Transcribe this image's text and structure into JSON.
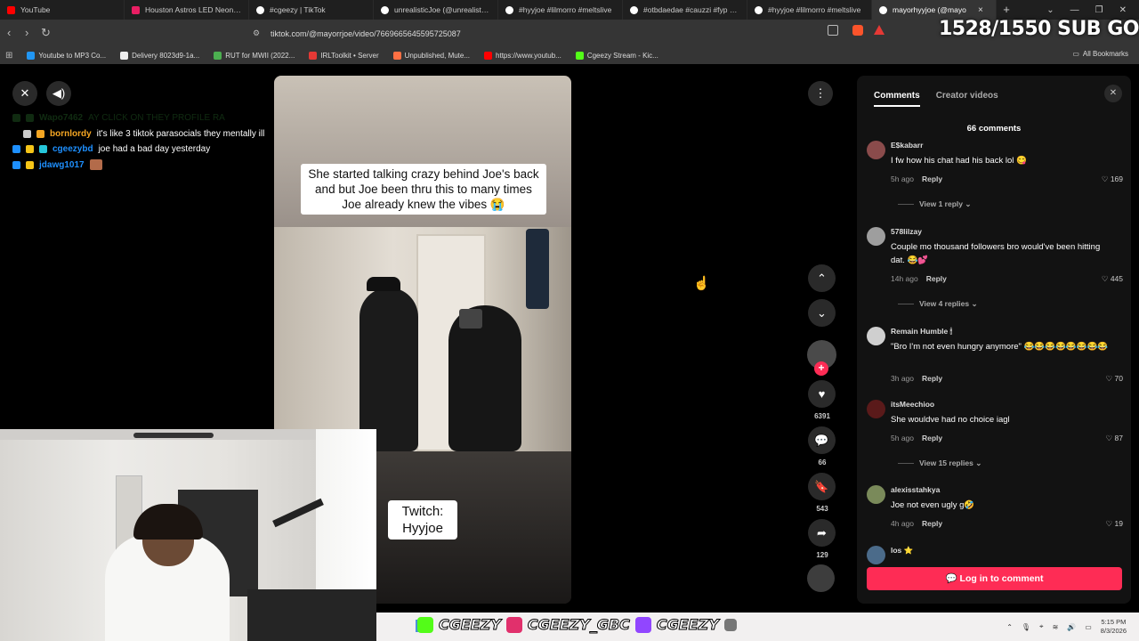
{
  "browser": {
    "tabs": [
      {
        "title": "YouTube",
        "color": "#ff0000"
      },
      {
        "title": "Houston Astros LED Neon Lig",
        "color": "#e91e63"
      },
      {
        "title": "#cgeezy | TikTok",
        "color": "#ffffff"
      },
      {
        "title": "unrealisticJoe (@unrealisticjoe",
        "color": "#ffffff"
      },
      {
        "title": "#hyyjoe #lilmorro #meltslive",
        "color": "#ffffff"
      },
      {
        "title": "#otbdaedae #cauzzi #fyp @C",
        "color": "#ffffff"
      },
      {
        "title": "#hyyjoe #lilmorro #meltslive",
        "color": "#ffffff"
      },
      {
        "title": "mayorhyyjoe (@mayo",
        "color": "#ffffff",
        "active": true
      }
    ],
    "tab_close": "×",
    "new_tab": "+",
    "url": "tiktok.com/@mayorrjoe/video/7669665645595725087",
    "bookmarks": [
      {
        "label": "Youtube to MP3 Co...",
        "color": "#2196f3"
      },
      {
        "label": "Delivery 8023d9-1a...",
        "color": "#eeeeee"
      },
      {
        "label": "RUT for MWII (2022...",
        "color": "#4caf50"
      },
      {
        "label": "IRLToolkit • Server",
        "color": "#e53935"
      },
      {
        "label": "Unpublished, Mute...",
        "color": "#ff7043"
      },
      {
        "label": "https://www.youtub...",
        "color": "#ff0000"
      },
      {
        "label": "Cgeezy Stream - Kic...",
        "color": "#53fc18"
      }
    ],
    "all_bookmarks": "All Bookmarks"
  },
  "overlay": {
    "sub_goal": "1528/1550 SUB GO"
  },
  "chat": [
    {
      "user": "Wapo7462",
      "color": "#2e7d32",
      "text": "AY CLICK ON THEY PROFILE RA",
      "faded": true
    },
    {
      "user": "bornlordy",
      "color": "#f5a623",
      "text": "it's like 3 tiktok parasocials they mentally ill"
    },
    {
      "user": "cgeezybd",
      "color": "#1e90ff",
      "text": "joe had a bad day yesterday"
    },
    {
      "user": "jdawg1017",
      "color": "#1e90ff",
      "text": ""
    }
  ],
  "video": {
    "caption": "She started talking crazy behind Joe's back and but Joe been thru this to many times  Joe already knew the vibes 😭",
    "twitch_line1": "Twitch:",
    "twitch_line2": "Hyyjoe"
  },
  "actions": {
    "likes": "6391",
    "comments": "66",
    "saves": "543",
    "shares": "129"
  },
  "panel": {
    "tab_comments": "Comments",
    "tab_creator": "Creator videos",
    "count": "66 comments",
    "login": "Log in to comment",
    "comments": [
      {
        "user": "E$kabarr",
        "text": "I fw how his chat had his back lol 😋",
        "time": "5h ago",
        "reply": "Reply",
        "likes": "169",
        "replies": "View 1 reply"
      },
      {
        "user": "578lilzay",
        "text": "Couple mo thousand followers bro would've been hitting dat. 😂💕",
        "time": "14h ago",
        "reply": "Reply",
        "likes": "445",
        "replies": "View 4 replies"
      },
      {
        "user": "Remain Humble 🕯",
        "text": "\"Bro I'm not even hungry anymore\" 😂😂😂😂😂😂😂😂",
        "time": "3h ago",
        "reply": "Reply",
        "likes": "70",
        "replies": ""
      },
      {
        "user": "itsMeechioo",
        "text": "She wouldve had no choice iagl",
        "time": "5h ago",
        "reply": "Reply",
        "likes": "87",
        "replies": "View 15 replies"
      },
      {
        "user": "alexisstahkya",
        "text": "Joe not even ugly g🤣",
        "time": "4h ago",
        "reply": "Reply",
        "likes": "19",
        "replies": ""
      },
      {
        "user": "los ⭐",
        "text": "",
        "time": "",
        "reply": "",
        "likes": "",
        "replies": ""
      }
    ]
  },
  "taskbar": {
    "social1": "CGEEZY",
    "social2": "CGEEZY_GBC",
    "social3": "CGEEZY",
    "time": "5:15 PM",
    "date": "8/3/2026"
  }
}
